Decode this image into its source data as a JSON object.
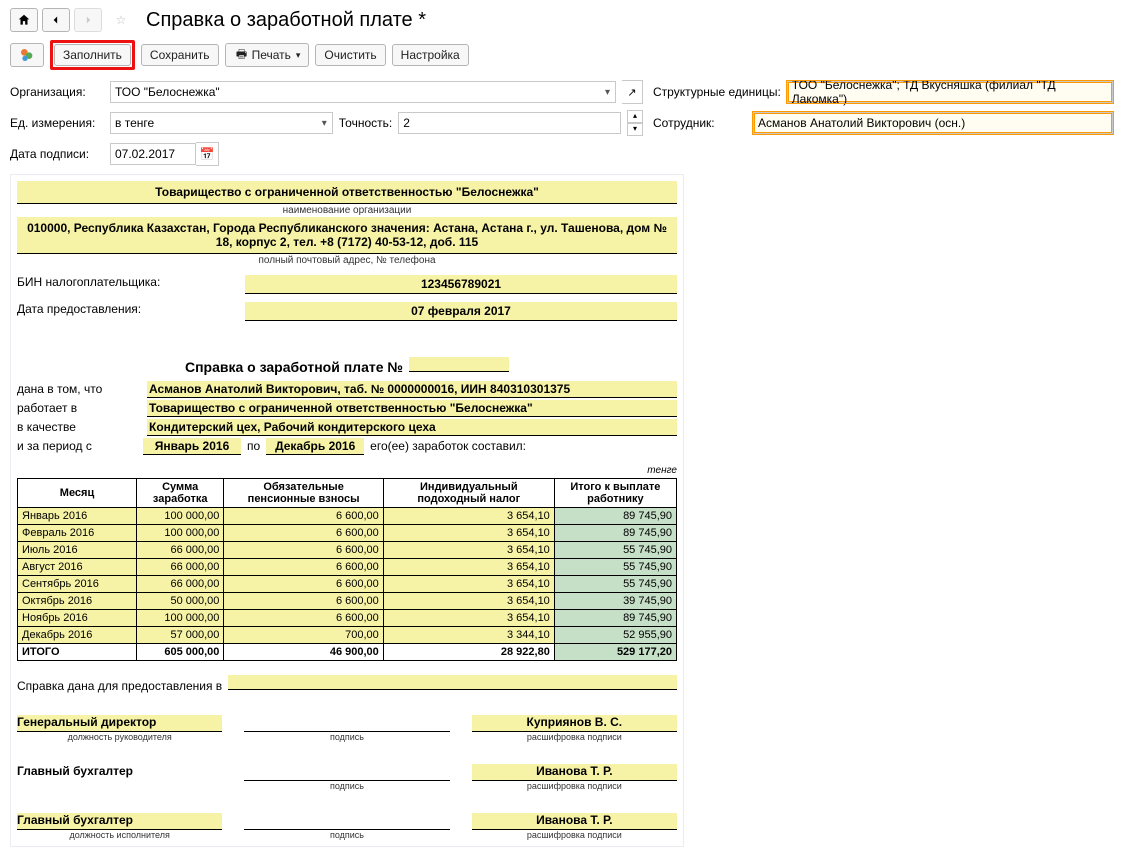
{
  "header": {
    "title": "Справка о заработной плате *"
  },
  "toolbar": {
    "fill": "Заполнить",
    "save": "Сохранить",
    "print": "Печать",
    "clear": "Очистить",
    "settings": "Настройка"
  },
  "form": {
    "org_lbl": "Организация:",
    "org_val": "ТОО \"Белоснежка\"",
    "units_lbl": "Структурные единицы:",
    "units_val": "ТОО \"Белоснежка\"; ТД Вкусняшка (филиал \"ТД Лакомка\")",
    "unit_lbl": "Ед. измерения:",
    "unit_val": "в тенге",
    "precision_lbl": "Точность:",
    "precision_val": "2",
    "employee_lbl": "Сотрудник:",
    "employee_val": "Асманов Анатолий Викторович (осн.)",
    "signdate_lbl": "Дата подписи:",
    "signdate_val": "07.02.2017"
  },
  "doc": {
    "org_name": "Товарищество с ограниченной ответственностью \"Белоснежка\"",
    "org_name_note": "наименование организации",
    "addr": "010000, Республика Казахстан, Города Республиканского значения: Астана, Астана г., ул. Ташенова, дом № 18, корпус 2, тел. +8 (7172) 40-53-12, доб. 115",
    "addr_note": "полный почтовый адрес, № телефона",
    "bin_lbl": "БИН налогоплательщика:",
    "bin_val": "123456789021",
    "date_lbl": "Дата предоставления:",
    "date_val": "07 февраля 2017",
    "title": "Справка о заработной плате №",
    "given_lbl": "дана в том, что",
    "given_val": "Асманов Анатолий Викторович, таб. № 0000000016, ИИН 840310301375",
    "works_lbl": "работает в",
    "works_val": "Товарищество с ограниченной ответственностью \"Белоснежка\"",
    "pos_lbl": "в качестве",
    "pos_val": "Кондитерский цех, Рабочий кондитерского цеха",
    "period_lbl": "и за период с",
    "period_from": "Январь 2016",
    "period_sep": "по",
    "period_to": "Декабрь 2016",
    "period_tail": "его(ее) заработок составил:",
    "currency_note": "тенге",
    "purpose_lbl": "Справка дана для предоставления в",
    "sign_roles": {
      "director": "Генеральный директор",
      "chief_acc": "Главный бухгалтер",
      "role_note1": "должность руководителя",
      "role_note2": "должность исполнителя",
      "sign_note": "подпись",
      "decode_note": "расшифровка подписи",
      "director_name": "Куприянов В. С.",
      "acc_name": "Иванова Т. Р."
    }
  },
  "table": {
    "headers": {
      "month": "Месяц",
      "earn": "Сумма заработка",
      "pension": "Обязательные пенсионные взносы",
      "tax": "Индивидуальный подоходный налог",
      "net": "Итого к выплате работнику"
    },
    "rows": [
      {
        "month": "Январь 2016",
        "earn": "100 000,00",
        "pension": "6 600,00",
        "tax": "3 654,10",
        "net": "89 745,90"
      },
      {
        "month": "Февраль 2016",
        "earn": "100 000,00",
        "pension": "6 600,00",
        "tax": "3 654,10",
        "net": "89 745,90"
      },
      {
        "month": "Июль 2016",
        "earn": "66 000,00",
        "pension": "6 600,00",
        "tax": "3 654,10",
        "net": "55 745,90"
      },
      {
        "month": "Август 2016",
        "earn": "66 000,00",
        "pension": "6 600,00",
        "tax": "3 654,10",
        "net": "55 745,90"
      },
      {
        "month": "Сентябрь 2016",
        "earn": "66 000,00",
        "pension": "6 600,00",
        "tax": "3 654,10",
        "net": "55 745,90"
      },
      {
        "month": "Октябрь 2016",
        "earn": "50 000,00",
        "pension": "6 600,00",
        "tax": "3 654,10",
        "net": "39 745,90"
      },
      {
        "month": "Ноябрь 2016",
        "earn": "100 000,00",
        "pension": "6 600,00",
        "tax": "3 654,10",
        "net": "89 745,90"
      },
      {
        "month": "Декабрь 2016",
        "earn": "57 000,00",
        "pension": "700,00",
        "tax": "3 344,10",
        "net": "52 955,90"
      }
    ],
    "totals": {
      "month": "ИТОГО",
      "earn": "605 000,00",
      "pension": "46 900,00",
      "tax": "28 922,80",
      "net": "529 177,20"
    }
  }
}
